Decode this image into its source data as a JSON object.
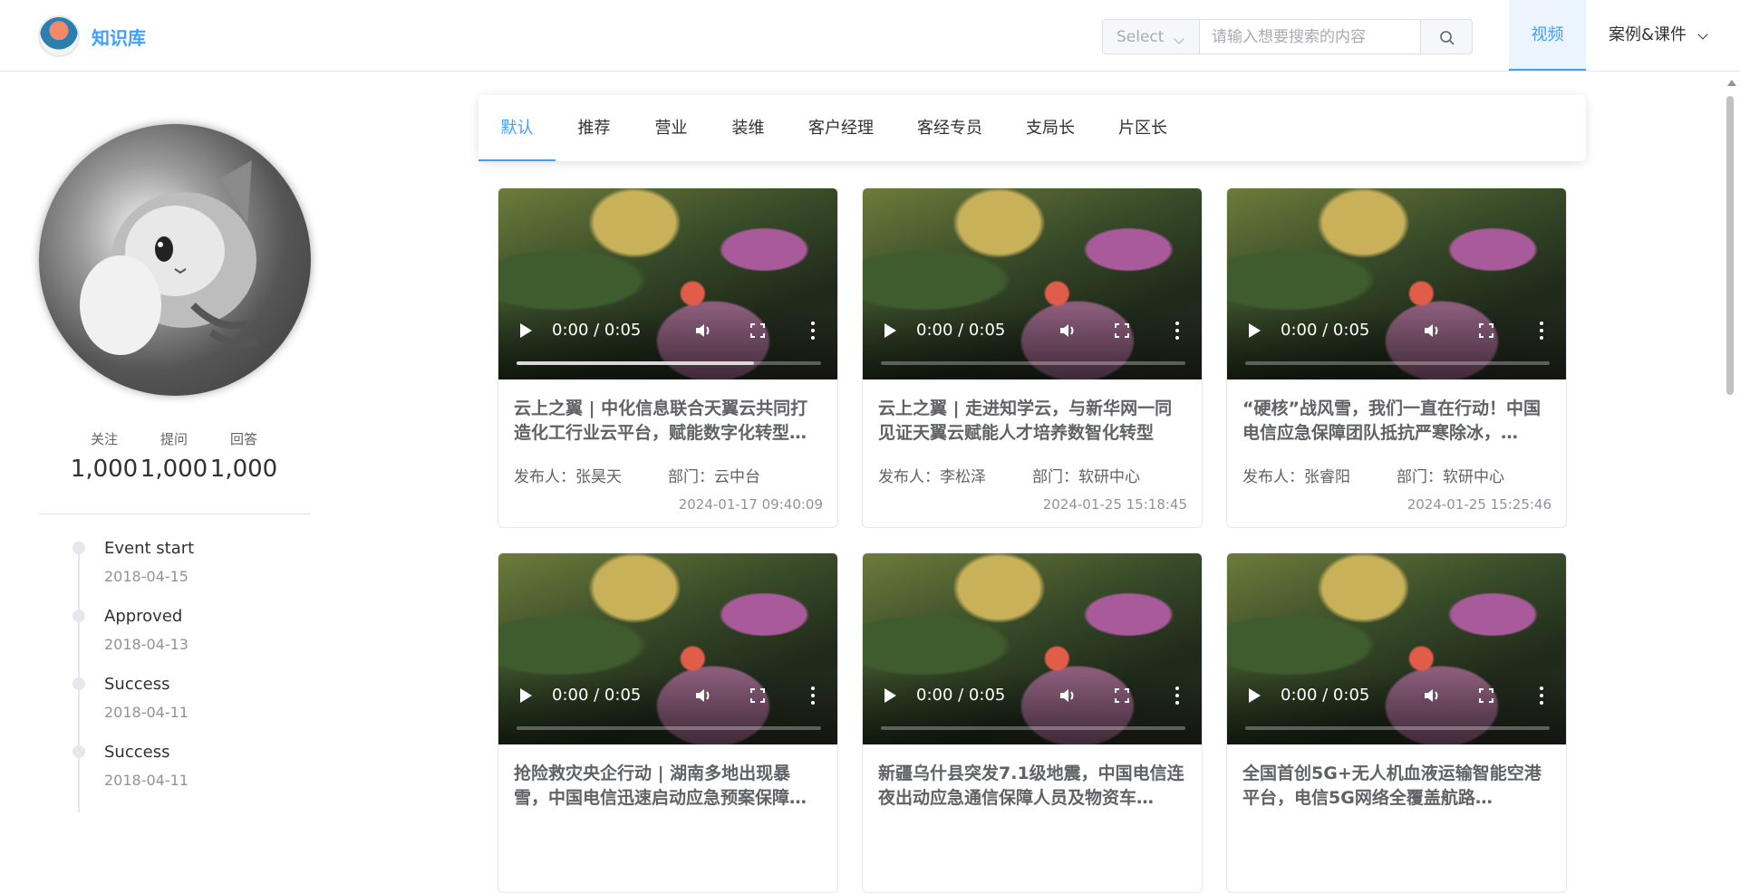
{
  "header": {
    "logo_text": "知识库",
    "select_placeholder": "Select",
    "search_placeholder": "请输入想要搜索的内容",
    "nav_video": "视频",
    "nav_cases": "案例&课件",
    "accent_color": "#409eff"
  },
  "profile": {
    "stats": [
      {
        "label": "关注",
        "value": "1,000"
      },
      {
        "label": "提问",
        "value": "1,000"
      },
      {
        "label": "回答",
        "value": "1,000"
      }
    ],
    "timeline": [
      {
        "content": "Event start",
        "timestamp": "2018-04-15"
      },
      {
        "content": "Approved",
        "timestamp": "2018-04-13"
      },
      {
        "content": "Success",
        "timestamp": "2018-04-11"
      },
      {
        "content": "Success",
        "timestamp": "2018-04-11"
      }
    ]
  },
  "tabs": [
    "默认",
    "推荐",
    "营业",
    "装维",
    "客户经理",
    "客经专员",
    "支局长",
    "片区长"
  ],
  "active_tab": 0,
  "cards": [
    {
      "video_time": "0:00 / 0:05",
      "progress": 0.78,
      "title": "云上之翼 | 中化信息联合天翼云共同打造化工行业云平台，赋能数字化转型…",
      "publisher": "发布人：张昊天",
      "department": "部门：云中台",
      "date": "2024-01-17 09:40:09"
    },
    {
      "video_time": "0:00 / 0:05",
      "progress": 0,
      "title": "云上之翼 | 走进知学云，与新华网一同见证天翼云赋能人才培养数智化转型",
      "publisher": "发布人：李松泽",
      "department": "部门：软研中心",
      "date": "2024-01-25 15:18:45"
    },
    {
      "video_time": "0:00 / 0:05",
      "progress": 0,
      "title": "“硬核”战风雪，我们一直在行动！中国电信应急保障团队抵抗严寒除冰，…",
      "publisher": "发布人：张睿阳",
      "department": "部门：软研中心",
      "date": "2024-01-25 15:25:46"
    },
    {
      "video_time": "0:00 / 0:05",
      "progress": 0,
      "title": "抢险救灾央企行动 | 湖南多地出现暴雪，中国电信迅速启动应急预案保障…",
      "publisher": "",
      "department": "",
      "date": ""
    },
    {
      "video_time": "0:00 / 0:05",
      "progress": 0,
      "title": "新疆乌什县突发7.1级地震，中国电信连夜出动应急通信保障人员及物资车…",
      "publisher": "",
      "department": "",
      "date": ""
    },
    {
      "video_time": "0:00 / 0:05",
      "progress": 0,
      "title": "全国首创5G+无人机血液运输智能空港平台，电信5G网络全覆盖航路…",
      "publisher": "",
      "department": "",
      "date": ""
    }
  ]
}
